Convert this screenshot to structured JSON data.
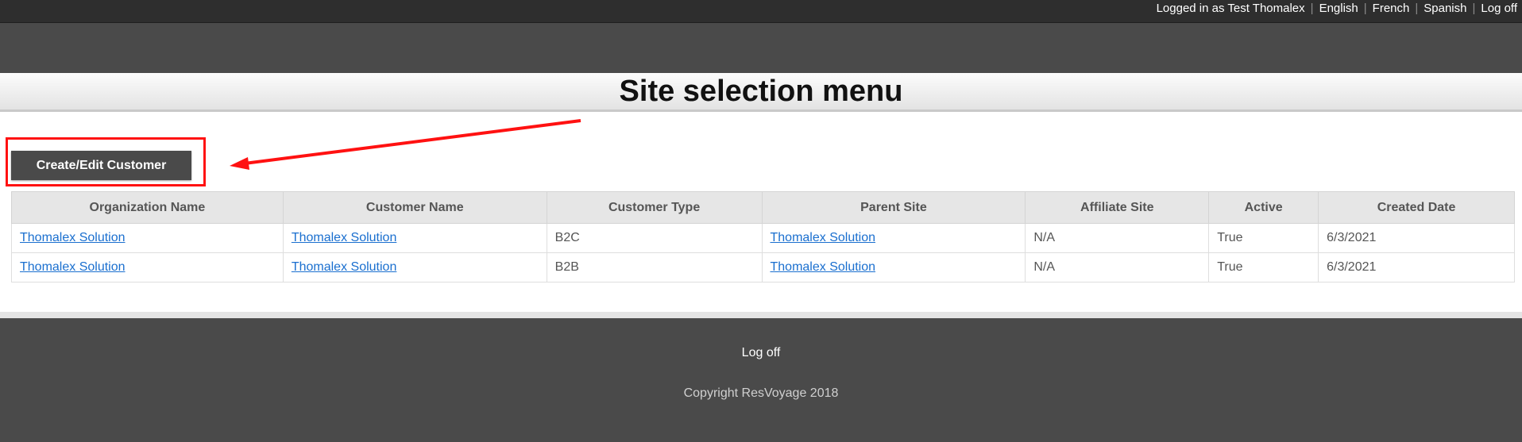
{
  "topbar": {
    "logged_in_text": "Logged in as Test Thomalex",
    "languages": [
      "English",
      "French",
      "Spanish"
    ],
    "logoff": "Log off"
  },
  "page": {
    "title": "Site selection menu"
  },
  "toolbar": {
    "create_edit_label": "Create/Edit Customer"
  },
  "table": {
    "columns": [
      "Organization Name",
      "Customer Name",
      "Customer Type",
      "Parent Site",
      "Affiliate Site",
      "Active",
      "Created Date"
    ],
    "rows": [
      [
        "Thomalex Solution",
        "Thomalex Solution",
        "B2C",
        "Thomalex Solution",
        "N/A",
        "True",
        "6/3/2021"
      ],
      [
        "Thomalex Solution",
        "Thomalex Solution",
        "B2B",
        "Thomalex Solution",
        "N/A",
        "True",
        "6/3/2021"
      ]
    ]
  },
  "footer": {
    "logoff": "Log off",
    "copyright": "Copyright ResVoyage 2018"
  },
  "colors": {
    "annotation": "#ff1111",
    "link": "#1a6fcf",
    "dark_band": "#4a4a4a"
  }
}
